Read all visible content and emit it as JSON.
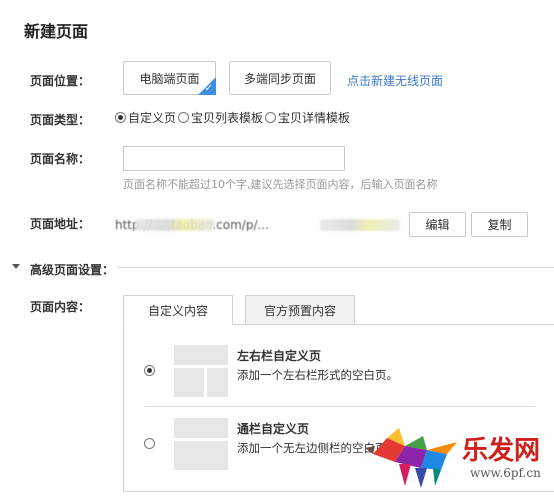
{
  "page_title": "新建页面",
  "location": {
    "label": "页面位置：",
    "options": [
      "电脑端页面",
      "多端同步页面"
    ],
    "selected_index": 0,
    "link": "点击新建无线页面"
  },
  "page_type": {
    "label": "页面类型：",
    "options": [
      "自定义页",
      "宝贝列表模板",
      "宝贝详情模板"
    ],
    "selected_index": 0
  },
  "page_name": {
    "label": "页面名称：",
    "value": "",
    "hint": "页面名称不能超过10个字,建议先选择页面内容，后输入页面名称"
  },
  "page_address": {
    "label": "页面地址：",
    "url_text": "http://... .taobao.com/p/...",
    "edit_label": "编辑",
    "copy_label": "复制"
  },
  "advanced": {
    "label": "高级页面设置："
  },
  "page_content": {
    "label": "页面内容：",
    "tabs": [
      "自定义内容",
      "官方预置内容"
    ],
    "active_tab": 0,
    "options": [
      {
        "title": "左右栏自定义页",
        "desc": "添加一个左右栏形式的空白页。",
        "selected": true
      },
      {
        "title": "通栏自定义页",
        "desc": "添加一个无左边侧栏的空白页。",
        "selected": false
      }
    ]
  },
  "watermark": {
    "brand": "乐发网",
    "url": "www.6pf.cn"
  },
  "colors": {
    "accent": "#3a8fe0",
    "link": "#3a79c8",
    "border": "#c9c9c9",
    "watermark_red": "#d0201c"
  }
}
